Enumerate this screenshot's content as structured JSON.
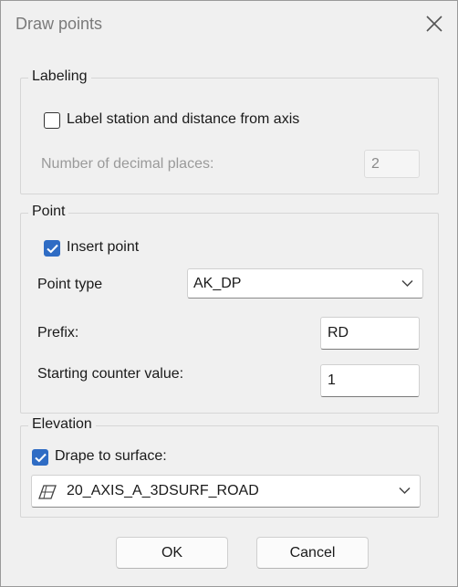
{
  "window": {
    "title": "Draw points",
    "close_icon": "close-icon"
  },
  "labeling": {
    "legend": "Labeling",
    "label_station": {
      "label": "Label station and distance from axis",
      "checked": false
    },
    "decimal_places": {
      "label": "Number of decimal places:",
      "value": "2",
      "disabled": true
    }
  },
  "point": {
    "legend": "Point",
    "insert_point": {
      "label": "Insert point",
      "checked": true
    },
    "point_type": {
      "label": "Point type",
      "value": "AK_DP"
    },
    "prefix": {
      "label": "Prefix:",
      "value": "RD"
    },
    "starting_counter": {
      "label": "Starting counter value:",
      "value": "1"
    }
  },
  "elevation": {
    "legend": "Elevation",
    "drape": {
      "label": "Drape to surface:",
      "checked": true
    },
    "surface": {
      "value": "20_AXIS_A_3DSURF_ROAD",
      "icon": "surface-icon"
    }
  },
  "buttons": {
    "ok": "OK",
    "cancel": "Cancel"
  },
  "colors": {
    "accent": "#2f6cc4",
    "background": "#f0f0f0",
    "disabled_text": "#9a9a9a"
  }
}
